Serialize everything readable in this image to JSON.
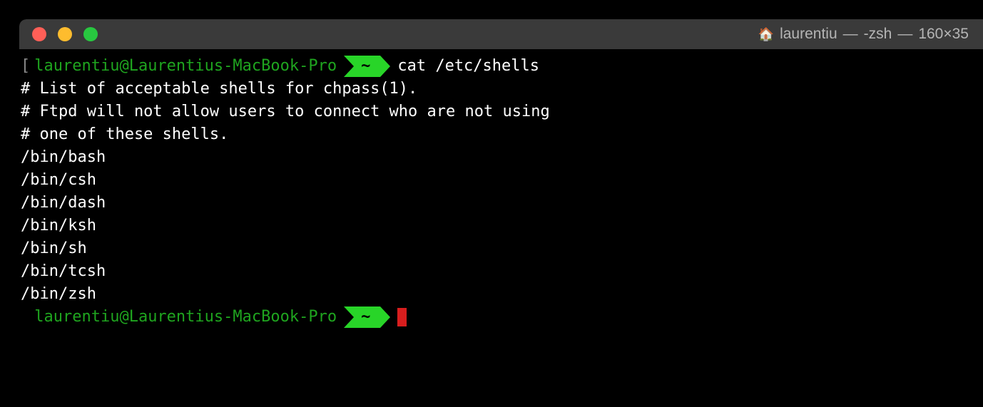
{
  "window": {
    "title_user": "laurentiu",
    "title_shell": "-zsh",
    "title_dims": "160×35"
  },
  "prompt1": {
    "bracket": "[",
    "user_host": "laurentiu@Laurentius-MacBook-Pro",
    "cwd": "~",
    "command": "cat /etc/shells"
  },
  "output": {
    "l1": "# List of acceptable shells for chpass(1).",
    "l2": "# Ftpd will not allow users to connect who are not using",
    "l3": "# one of these shells.",
    "l4": "",
    "l5": "/bin/bash",
    "l6": "/bin/csh",
    "l7": "/bin/dash",
    "l8": "/bin/ksh",
    "l9": "/bin/sh",
    "l10": "/bin/tcsh",
    "l11": "/bin/zsh"
  },
  "prompt2": {
    "user_host": "laurentiu@Laurentius-MacBook-Pro",
    "cwd": "~"
  }
}
